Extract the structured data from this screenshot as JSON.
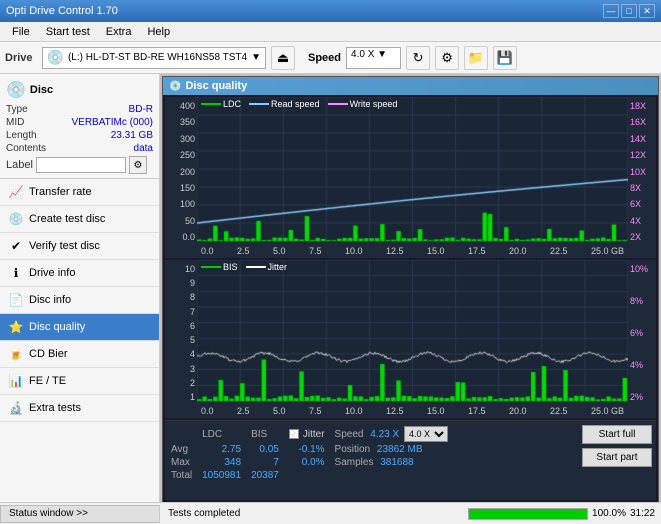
{
  "app": {
    "title": "Opti Drive Control 1.70",
    "title_bar_min": "—",
    "title_bar_max": "□",
    "title_bar_close": "✕"
  },
  "menu": {
    "items": [
      "File",
      "Start test",
      "Extra",
      "Help"
    ]
  },
  "toolbar": {
    "drive_label": "Drive",
    "drive_value": "(L:) HL-DT-ST BD-RE WH16NS58 TST4",
    "speed_label": "Speed",
    "speed_value": "4.0 X"
  },
  "disc": {
    "section_label": "Disc",
    "type_label": "Type",
    "type_value": "BD-R",
    "mid_label": "MID",
    "mid_value": "VERBATIMc (000)",
    "length_label": "Length",
    "length_value": "23.31 GB",
    "contents_label": "Contents",
    "contents_value": "data",
    "label_label": "Label"
  },
  "nav": {
    "items": [
      {
        "id": "transfer-rate",
        "label": "Transfer rate",
        "icon": "📈"
      },
      {
        "id": "create-test-disc",
        "label": "Create test disc",
        "icon": "💿"
      },
      {
        "id": "verify-test-disc",
        "label": "Verify test disc",
        "icon": "✔"
      },
      {
        "id": "drive-info",
        "label": "Drive info",
        "icon": "ℹ"
      },
      {
        "id": "disc-info",
        "label": "Disc info",
        "icon": "📄"
      },
      {
        "id": "disc-quality",
        "label": "Disc quality",
        "icon": "⭐",
        "active": true
      },
      {
        "id": "cd-bier",
        "label": "CD Bier",
        "icon": "🍺"
      },
      {
        "id": "fe-te",
        "label": "FE / TE",
        "icon": "📊"
      },
      {
        "id": "extra-tests",
        "label": "Extra tests",
        "icon": "🔬"
      }
    ]
  },
  "disc_quality": {
    "title": "Disc quality",
    "legend": {
      "ldc_label": "LDC",
      "read_label": "Read speed",
      "write_label": "Write speed",
      "bis_label": "BIS",
      "jitter_label": "Jitter"
    },
    "chart1": {
      "y_labels_left": [
        "400",
        "350",
        "300",
        "250",
        "200",
        "150",
        "100",
        "50",
        "0.0"
      ],
      "y_labels_right": [
        "18X",
        "16X",
        "14X",
        "12X",
        "10X",
        "8X",
        "6X",
        "4X",
        "2X"
      ],
      "x_labels": [
        "0.0",
        "2.5",
        "5.0",
        "7.5",
        "10.0",
        "12.5",
        "15.0",
        "17.5",
        "20.0",
        "22.5",
        "25.0 GB"
      ]
    },
    "chart2": {
      "y_labels_left": [
        "10",
        "9",
        "8",
        "7",
        "6",
        "5",
        "4",
        "3",
        "2",
        "1"
      ],
      "y_labels_right": [
        "10%",
        "8%",
        "6%",
        "4%",
        "2%"
      ],
      "x_labels": [
        "0.0",
        "2.5",
        "5.0",
        "7.5",
        "10.0",
        "12.5",
        "15.0",
        "17.5",
        "20.0",
        "22.5",
        "25.0 GB"
      ]
    },
    "stats": {
      "headers": [
        "",
        "LDC",
        "BIS",
        "",
        "Jitter",
        "Speed"
      ],
      "avg_label": "Avg",
      "max_label": "Max",
      "total_label": "Total",
      "ldc_avg": "2.75",
      "ldc_max": "348",
      "ldc_total": "1050981",
      "bis_avg": "0.05",
      "bis_max": "7",
      "bis_total": "20387",
      "jitter_checked": true,
      "jitter_avg": "-0.1%",
      "jitter_max": "0.0%",
      "speed_label": "Speed",
      "speed_value": "4.23 X",
      "speed_dropdown": "4.0 X",
      "position_label": "Position",
      "position_value": "23862 MB",
      "samples_label": "Samples",
      "samples_value": "381688"
    },
    "buttons": {
      "start_full": "Start full",
      "start_part": "Start part"
    }
  },
  "status": {
    "window_btn": "Status window >>",
    "text": "Tests completed",
    "progress": 100,
    "progress_text": "100.0%",
    "time": "31:22"
  }
}
